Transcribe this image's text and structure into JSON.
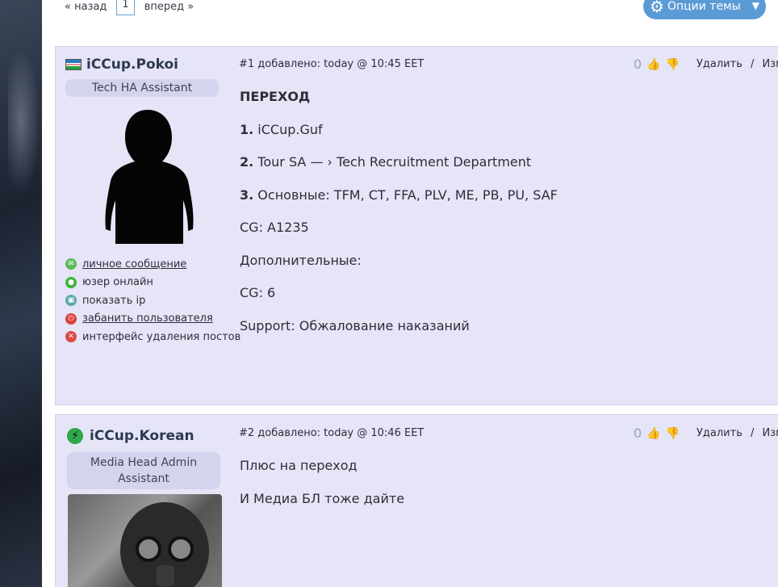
{
  "pager": {
    "prev": "« назад",
    "current": "1",
    "next": "вперед »"
  },
  "options_button": {
    "label": "Опции темы"
  },
  "colors": {
    "accent": "#5b9bd5",
    "post_bg": "#e5e5f7",
    "role_bg": "#d4d4ef"
  },
  "posts": [
    {
      "username": "iCCup.Pokoi",
      "role": "Tech HA Assistant",
      "header": "#1 добавлено: today @ 10:45 EET",
      "votes": "0",
      "delete": "Удалить",
      "sep": "/",
      "edit": "Изме",
      "links": [
        {
          "icon": "message-icon",
          "label": "личное сообщение"
        },
        {
          "icon": "online-icon",
          "label": "юзер онлайн"
        },
        {
          "icon": "ip-icon",
          "label": "показать ip"
        },
        {
          "icon": "ban-icon",
          "label": "забанить пользователя"
        },
        {
          "icon": "delete-posts-icon",
          "label": "интерфейс удаления постов"
        }
      ],
      "body": [
        {
          "bold": "ПЕРЕХОД",
          "text": ""
        },
        {
          "bold": "1.",
          "text": " iCCup.Guf"
        },
        {
          "bold": "2.",
          "text": " Tour SA — › Tech Recruitment Department"
        },
        {
          "bold": "3.",
          "text": " Основные: TFM, CT, FFA, PLV, ME, PB, PU, SAF"
        },
        {
          "bold": "",
          "text": "CG: A1235"
        },
        {
          "bold": "",
          "text": "Дополнительные:"
        },
        {
          "bold": "",
          "text": "CG: 6"
        },
        {
          "bold": "",
          "text": "Support: Обжалование наказаний"
        }
      ]
    },
    {
      "username": "iCCup.Korean",
      "role": "Media Head Admin Assistant",
      "header": "#2 добавлено: today @ 10:46 EET",
      "votes": "0",
      "delete": "Удалить",
      "sep": "/",
      "edit": "Изме",
      "body": [
        {
          "bold": "",
          "text": "Плюс на переход"
        },
        {
          "bold": "",
          "text": "И Медиа БЛ тоже дайте"
        }
      ]
    }
  ]
}
